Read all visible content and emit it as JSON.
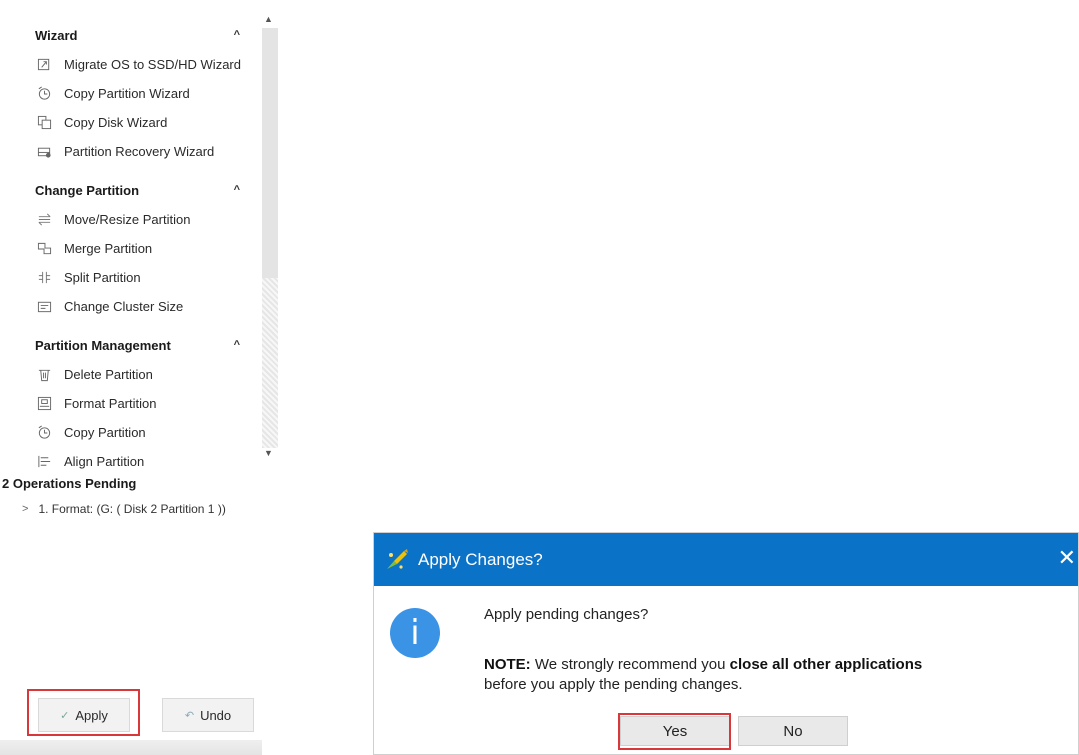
{
  "sidebar": {
    "sections": [
      {
        "title": "Wizard",
        "items": [
          {
            "label": "Migrate OS to SSD/HD Wizard",
            "icon": "migrate-os-icon"
          },
          {
            "label": "Copy Partition Wizard",
            "icon": "copy-partition-icon"
          },
          {
            "label": "Copy Disk Wizard",
            "icon": "copy-disk-icon"
          },
          {
            "label": "Partition Recovery Wizard",
            "icon": "partition-recovery-icon"
          }
        ]
      },
      {
        "title": "Change Partition",
        "items": [
          {
            "label": "Move/Resize Partition",
            "icon": "move-resize-icon"
          },
          {
            "label": "Merge Partition",
            "icon": "merge-partition-icon"
          },
          {
            "label": "Split Partition",
            "icon": "split-partition-icon"
          },
          {
            "label": "Change Cluster Size",
            "icon": "cluster-size-icon"
          }
        ]
      },
      {
        "title": "Partition Management",
        "items": [
          {
            "label": "Delete Partition",
            "icon": "delete-icon"
          },
          {
            "label": "Format Partition",
            "icon": "format-icon"
          },
          {
            "label": "Copy Partition",
            "icon": "copy-partition-icon"
          },
          {
            "label": "Align Partition",
            "icon": "align-icon"
          }
        ]
      }
    ],
    "pending": {
      "title": "2 Operations Pending",
      "items": [
        "1. Format: (G: ( Disk 2 Partition 1 ))"
      ]
    },
    "buttons": {
      "apply": "Apply",
      "undo": "Undo"
    }
  },
  "dialog": {
    "title": "Apply Changes?",
    "question": "Apply pending changes?",
    "note_label": "NOTE:",
    "note_text_1": "We strongly recommend you",
    "note_emphasis": "close all other applications",
    "note_text_2": "before you apply the pending changes.",
    "yes": "Yes",
    "no": "No"
  },
  "colors": {
    "titlebar": "#0a72c7",
    "info_icon": "#3b93e6",
    "highlight": "#d9383b"
  }
}
